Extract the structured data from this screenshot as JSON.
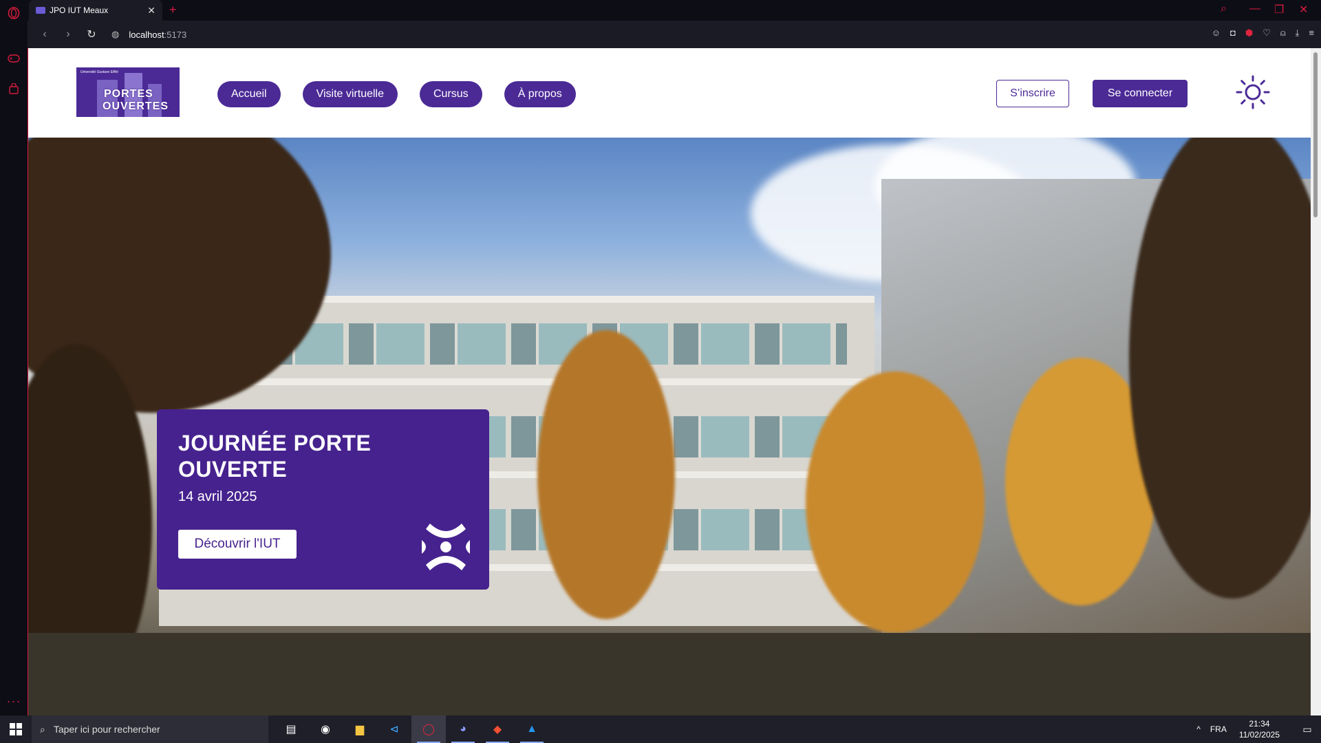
{
  "browser": {
    "tab_title": "JPO IUT Meaux",
    "url_host": "localhost",
    "url_port": ":5173"
  },
  "site": {
    "logo": {
      "line1": "PORTES",
      "line2": "OUVERTES",
      "mini": "Université Gustave Eiffel"
    },
    "nav": [
      "Accueil",
      "Visite virtuelle",
      "Cursus",
      "À propos"
    ],
    "signup_label": "S’inscrire",
    "login_label": "Se connecter",
    "theme_icon": "sun-icon",
    "accent": "#4b2a96"
  },
  "hero": {
    "title": "JOURNÉE PORTE OUVERTE",
    "date": "14 avril 2025",
    "cta": "Découvrir l'IUT"
  },
  "taskbar": {
    "search_placeholder": "Taper ici pour rechercher",
    "apps": [
      "task-view-icon",
      "steam-icon",
      "file-explorer-icon",
      "vscode-icon",
      "opera-icon",
      "discord-icon",
      "git-icon",
      "docker-icon"
    ],
    "lang": "FRA",
    "time": "21:34",
    "date": "11/02/2025"
  }
}
